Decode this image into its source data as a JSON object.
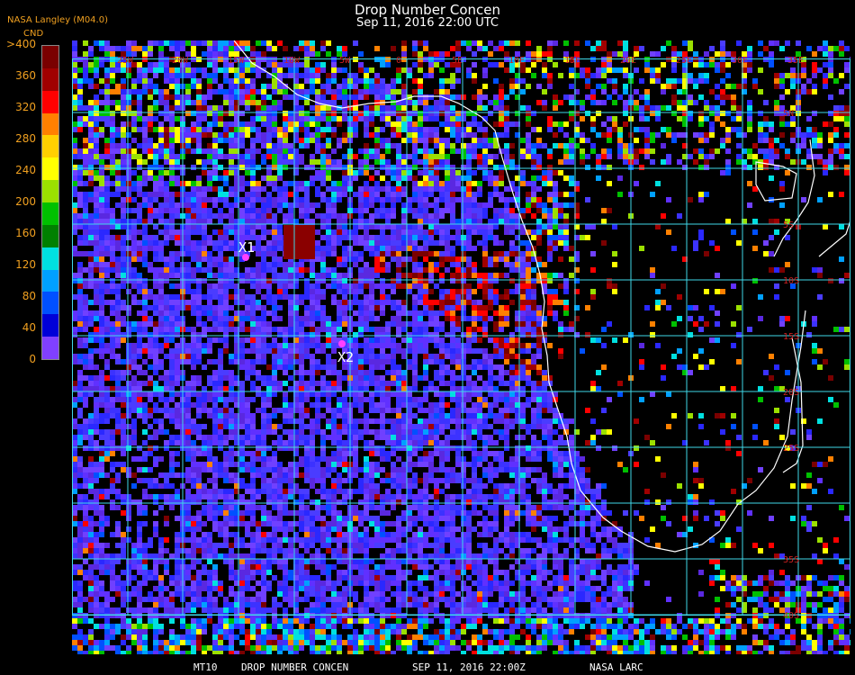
{
  "header": {
    "credit": "NASA Langley (M04.0)",
    "title": "Drop Number Concen",
    "subtitle": "Sep 11, 2016 22:00 UTC"
  },
  "colorbar": {
    "unit": "CND",
    "labels": [
      ">400",
      "360",
      "320",
      "280",
      "240",
      "200",
      "160",
      "120",
      "80",
      "40",
      "0"
    ],
    "colors": [
      "#7a0000",
      "#a00000",
      "#ff0000",
      "#ff8000",
      "#ffd000",
      "#ffff00",
      "#9be000",
      "#00c000",
      "#008000",
      "#00e0e0",
      "#00a0ff",
      "#0050ff",
      "#0000d8",
      "#8040ff"
    ]
  },
  "map": {
    "grid_color": "#40d8e8",
    "coast_color": "#ffffff",
    "lon_labels": [
      "25W",
      "20W",
      "15W",
      "10W",
      "5W",
      "0",
      "5E",
      "10E",
      "15E",
      "20E",
      "25E",
      "30E",
      "35E"
    ],
    "lat_labels": [
      "5N",
      "5S",
      "10S",
      "15S",
      "20S",
      "25S",
      "35S",
      "40S"
    ],
    "markers": [
      {
        "label": "X1",
        "color": "#ff40ff"
      },
      {
        "label": "X2",
        "color": "#ff40ff"
      }
    ]
  },
  "footer": {
    "source": "MT10",
    "product": "DROP NUMBER CONCEN",
    "date": "SEP 11, 2016 22:00Z",
    "agency": "NASA LARC"
  }
}
